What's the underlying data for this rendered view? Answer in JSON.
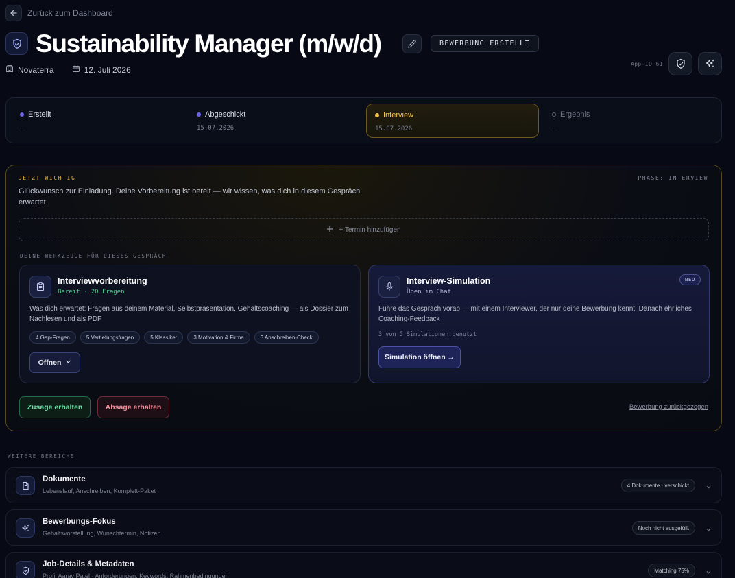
{
  "back": {
    "label": "Zurück zum Dashboard"
  },
  "header": {
    "title": "Sustainability Manager (m/w/d)",
    "status": "BEWERBUNG ERSTELLT",
    "company": "Novaterra",
    "date": "12. Juli 2026",
    "app_id": "App-ID 61"
  },
  "stepper": [
    {
      "label": "Erstellt",
      "date": "—",
      "color": "#6b63e6"
    },
    {
      "label": "Abgeschickt",
      "date": "15.07.2026",
      "color": "#6b63e6"
    },
    {
      "label": "Interview",
      "date": "15.07.2026",
      "color": "#f2c44a"
    },
    {
      "label": "Ergebnis",
      "date": "—",
      "color": "#6e7383"
    }
  ],
  "now": {
    "kicker": "JETZT WICHTIG",
    "phase": "PHASE: INTERVIEW",
    "text": "Glückwunsch zur Einladung. Deine Vorbereitung ist bereit — wir wissen, was dich in diesem Gespräch erwartet",
    "add_term": "+ Termin hinzufügen",
    "tools_label": "DEINE WERKZEUGE FÜR DIESES GESPRÄCH"
  },
  "prep_card": {
    "title": "Interviewvorbereitung",
    "sub": "Bereit · 20 Fragen",
    "desc": "Was dich erwartet: Fragen aus deinem Material, Selbstpräsentation, Gehaltscoaching — als Dossier zum Nachlesen und als PDF",
    "chips": [
      "4 Gap-Fragen",
      "5 Vertiefungsfragen",
      "5 Klassiker",
      "3 Motivation & Firma",
      "3 Anschreiben-Check"
    ],
    "open_label": "Öffnen"
  },
  "sim_card": {
    "title": "Interview-Simulation",
    "sub": "Üben im Chat",
    "badge": "NEU",
    "desc": "Führe das Gespräch vorab — mit einem Interviewer, der nur deine Bewerbung kennt. Danach ehrliches Coaching-Feedback",
    "usage": "3 von 5 Simulationen genutzt",
    "button": "Simulation öffnen →"
  },
  "actions": {
    "accept": "Zusage erhalten",
    "reject": "Absage erhalten",
    "withdraw": "Bewerbung zurückgezogen"
  },
  "more": {
    "label": "WEITERE BEREICHE",
    "sections": [
      {
        "title": "Dokumente",
        "sub": "Lebenslauf, Anschreiben, Komplett-Paket",
        "badge": "4 Dokumente · verschickt",
        "icon": "document-icon"
      },
      {
        "title": "Bewerbungs-Fokus",
        "sub": "Gehaltsvorstellung, Wunschtermin, Notizen",
        "badge": "Noch nicht ausgefüllt",
        "icon": "sparkle-icon"
      },
      {
        "title": "Job-Details & Metadaten",
        "sub": "Profil Aarav Patel · Anforderungen, Keywords, Rahmenbedingungen",
        "badge": "Matching 75%",
        "icon": "shield-icon"
      }
    ]
  }
}
